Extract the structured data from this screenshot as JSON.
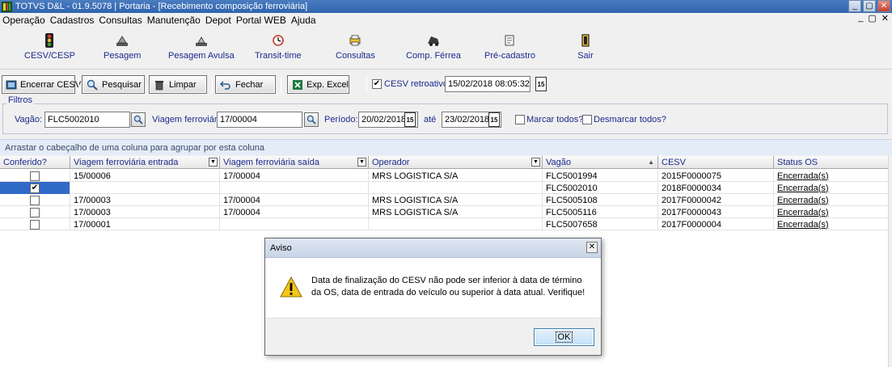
{
  "window": {
    "title": "TOTVS D&L - 01.9.5078 | Portaria - [Recebimento composição ferroviária]",
    "controls": [
      "_",
      "▢",
      "✕"
    ]
  },
  "menu": {
    "items": [
      "Operação",
      "Cadastros",
      "Consultas",
      "Manutenção",
      "Depot",
      "Portal WEB",
      "Ajuda"
    ],
    "mdi_controls": [
      "_",
      "▢",
      "✕"
    ]
  },
  "toolbar": {
    "items": [
      {
        "label": "CESV/CESP",
        "icon": "traffic-light-icon"
      },
      {
        "label": "Pesagem",
        "icon": "scale-icon"
      },
      {
        "label": "Pesagem Avulsa",
        "icon": "scale-single-icon"
      },
      {
        "label": "Transit-time",
        "icon": "clock-icon"
      },
      {
        "label": "Consultas",
        "icon": "printer-icon"
      },
      {
        "label": "Comp. Férrea",
        "icon": "train-icon"
      },
      {
        "label": "Pré-cadastro",
        "icon": "document-icon"
      },
      {
        "label": "Sair",
        "icon": "exit-door-icon"
      }
    ]
  },
  "actions": {
    "encerrar": "Encerrar CESV",
    "pesquisar": "Pesquisar",
    "limpar": "Limpar",
    "fechar": "Fechar",
    "exp_excel": "Exp. Excel",
    "cesv_retroativo_label": "CESV retroativo?",
    "cesv_retroativo_checked": true,
    "cesv_retroativo_date": "15/02/2018 08:05:32"
  },
  "filters": {
    "legend": "Filtros",
    "vagao_label": "Vagão:",
    "vagao_value": "FLC5002010",
    "viagem_label": "Viagem ferroviária:",
    "viagem_value": "17/00004",
    "periodo_label": "Período:",
    "periodo_start": "20/02/2018",
    "ate_label": "até",
    "periodo_end": "23/02/2018",
    "marcar_todos": "Marcar todos?",
    "desmarcar_todos": "Desmarcar todos?",
    "calendar_glyph": "15"
  },
  "grid": {
    "group_hint": "Arrastar o cabeçalho de uma coluna para agrupar por esta coluna",
    "columns": [
      "Conferido?",
      "Viagem ferroviária entrada",
      "Viagem ferroviária saída",
      "Operador",
      "Vagão",
      "CESV",
      "Status OS"
    ],
    "rows": [
      {
        "conferido": "",
        "entrada": "15/00006",
        "saida": "17/00004",
        "operador": "MRS LOGISTICA S/A",
        "vagao": "FLC5001994",
        "cesv": "2015F0000075",
        "status": "Encerrada(s)"
      },
      {
        "conferido": "✔",
        "entrada": "",
        "saida": "",
        "operador": "",
        "vagao": "FLC5002010",
        "cesv": "2018F0000034",
        "status": "Encerrada(s)"
      },
      {
        "conferido": "",
        "entrada": "17/00003",
        "saida": "17/00004",
        "operador": "MRS LOGISTICA S/A",
        "vagao": "FLC5005108",
        "cesv": "2017F0000042",
        "status": "Encerrada(s)"
      },
      {
        "conferido": "",
        "entrada": "17/00003",
        "saida": "17/00004",
        "operador": "MRS LOGISTICA S/A",
        "vagao": "FLC5005116",
        "cesv": "2017F0000043",
        "status": "Encerrada(s)"
      },
      {
        "conferido": "",
        "entrada": "17/00001",
        "saida": "",
        "operador": "",
        "vagao": "FLC5007658",
        "cesv": "2017F0000004",
        "status": "Encerrada(s)"
      }
    ]
  },
  "dialog": {
    "title": "Aviso",
    "message": "Data de finalização do CESV não pode ser inferior à data de término da OS, data de entrada do veículo ou superior à data atual. Verifique!",
    "ok_label": "OK",
    "close_glyph": "✕"
  }
}
